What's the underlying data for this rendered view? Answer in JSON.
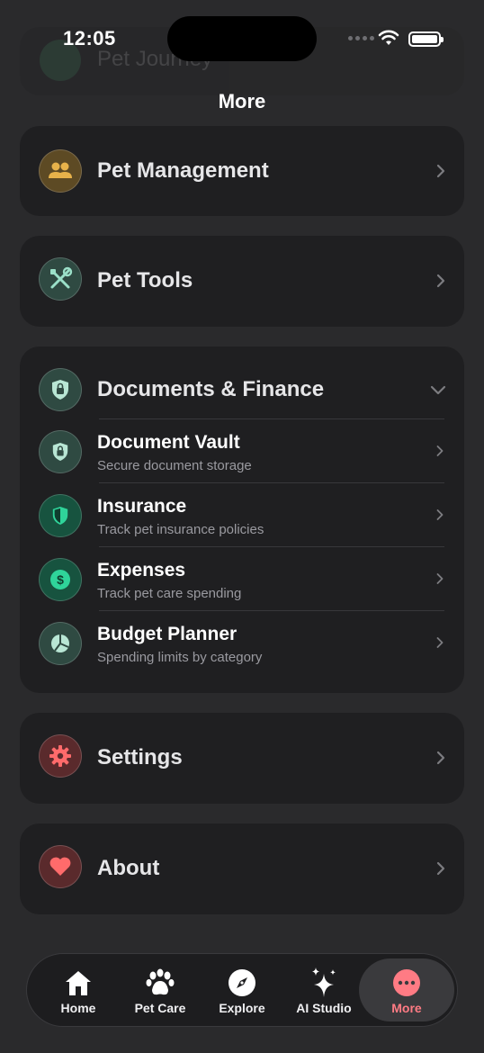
{
  "status": {
    "time": "12:05"
  },
  "ghost": {
    "label": "Pet Journey"
  },
  "header": {
    "title": "More"
  },
  "sections": {
    "pet_management": {
      "label": "Pet Management"
    },
    "pet_tools": {
      "label": "Pet Tools"
    },
    "documents_finance": {
      "label": "Documents & Finance",
      "items": [
        {
          "title": "Document Vault",
          "desc": "Secure document storage",
          "icon": "lock-shield-icon"
        },
        {
          "title": "Insurance",
          "desc": "Track pet insurance policies",
          "icon": "shield-icon"
        },
        {
          "title": "Expenses",
          "desc": "Track pet care spending",
          "icon": "dollar-icon"
        },
        {
          "title": "Budget Planner",
          "desc": "Spending limits by category",
          "icon": "pie-chart-icon"
        }
      ]
    },
    "settings": {
      "label": "Settings"
    },
    "about": {
      "label": "About"
    }
  },
  "tabs": [
    {
      "label": "Home",
      "icon": "home-icon"
    },
    {
      "label": "Pet Care",
      "icon": "paw-icon"
    },
    {
      "label": "Explore",
      "icon": "compass-icon"
    },
    {
      "label": "AI Studio",
      "icon": "sparkles-icon"
    },
    {
      "label": "More",
      "icon": "more-icon",
      "active": true
    }
  ],
  "colors": {
    "background": "#2a2a2c",
    "card": "#1f1f21",
    "accent": "#ff7b84",
    "management": "#e7b24a",
    "tools": "#6ec9ad",
    "finance_green": "#2fd49a",
    "settings_red": "#ff6b6b"
  }
}
